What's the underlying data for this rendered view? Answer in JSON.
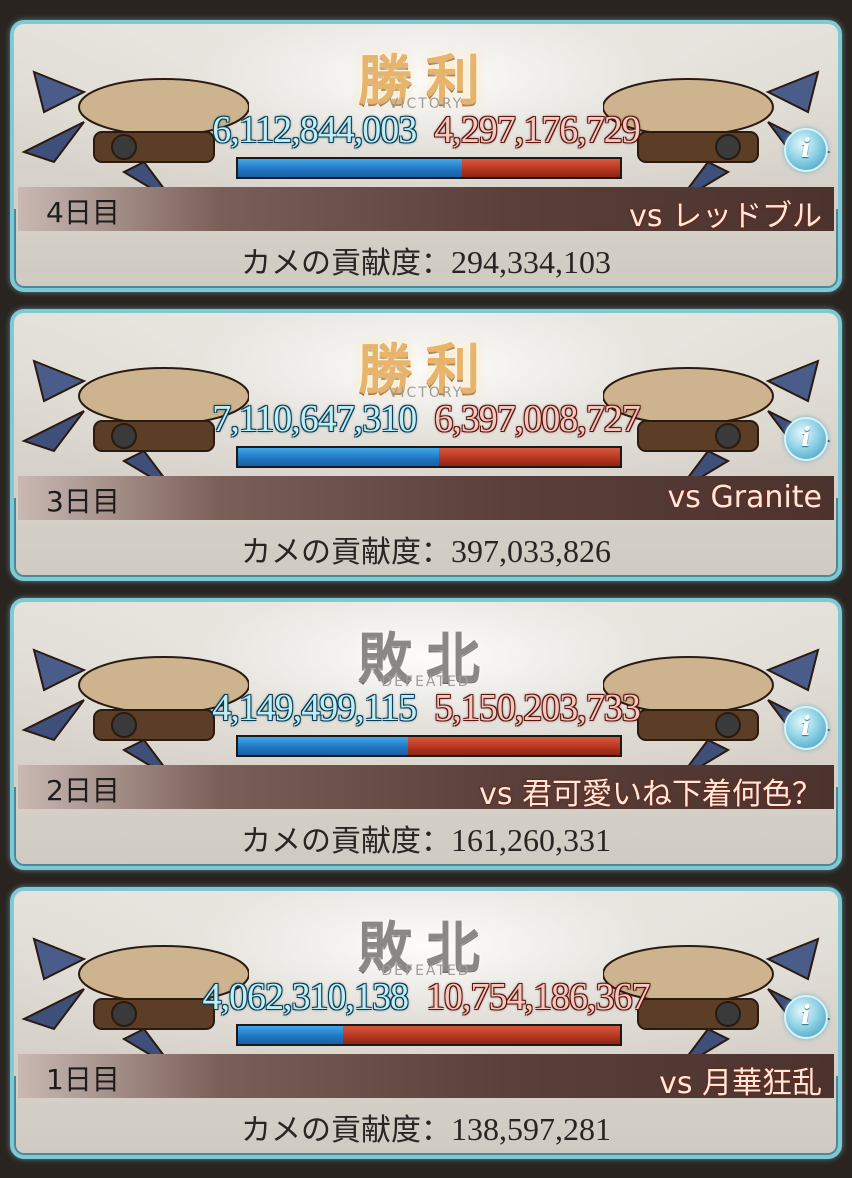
{
  "colors": {
    "own_bar": "#1f74c0",
    "opp_bar": "#b3341f",
    "card_border": "#7fc9d6",
    "win_title": "#e8b46a",
    "lose_title": "#8a8884"
  },
  "contrib_label": "カメの貢献度：",
  "cards": [
    {
      "result": "勝利",
      "result_sub": "VICTORY",
      "result_type": "win",
      "own_score": "6,112,844,003",
      "opp_score": "4,297,176,729",
      "own_ratio": 0.587,
      "day": "4日目",
      "opponent": "vs レッドブル",
      "contribution": "294,334,103"
    },
    {
      "result": "勝利",
      "result_sub": "VICTORY",
      "result_type": "win",
      "own_score": "7,110,647,310",
      "opp_score": "6,397,008,727",
      "own_ratio": 0.526,
      "day": "3日目",
      "opponent": "vs Granite",
      "contribution": "397,033,826"
    },
    {
      "result": "敗北",
      "result_sub": "DEFEATED",
      "result_type": "lose",
      "own_score": "4,149,499,115",
      "opp_score": "5,150,203,733",
      "own_ratio": 0.446,
      "day": "2日目",
      "opponent": "vs 君可愛いね下着何色？",
      "contribution": "161,260,331"
    },
    {
      "result": "敗北",
      "result_sub": "DEFEATED",
      "result_type": "lose",
      "own_score": "4,062,310,138",
      "opp_score": "10,754,186,367",
      "own_ratio": 0.274,
      "day": "1日目",
      "opponent": "vs 月華狂乱",
      "contribution": "138,597,281"
    }
  ]
}
